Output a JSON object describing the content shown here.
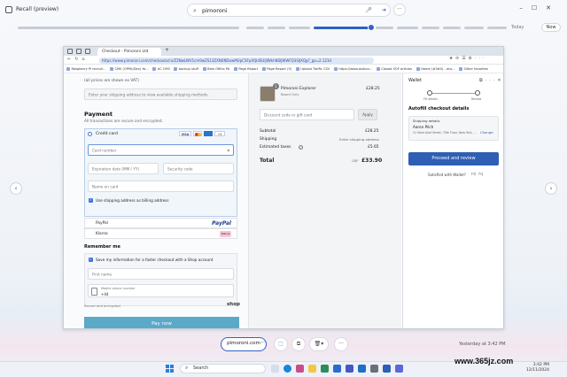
{
  "app": {
    "title": "Recall (preview)"
  },
  "search": {
    "query": "pimoroni"
  },
  "timeline": {
    "today_label": "Today",
    "now_label": "Now"
  },
  "browser": {
    "tab_title": "Checkout - Pimoroni Ltd",
    "url": "https://www.pimoroni.com/checkouts/cn/Z2NwLWV1cm9wZS13ZXN0NDowMUpCSFpXQldSUlJIWkhNSlJWWFQ3SlJXQg?_ga=2.1234",
    "bookmarks": [
      "Raspberry Pi recruit...",
      "CMS (OPM)(Dev) Yo...",
      "AC CMS",
      "backup stuff",
      "Best Office PA",
      "Page Report",
      "Page Report (5)",
      "Upload Traffic CSV",
      "https://www.avalon...",
      "Closed SOF articles",
      "Home (#3#0) - ans...",
      "Other favorites"
    ]
  },
  "checkout": {
    "prices_note": "(all prices are shown ex VAT)",
    "shipping_hint": "Enter your shipping address to view available shipping methods.",
    "payment_heading": "Payment",
    "payment_sub": "All transactions are secure and encrypted.",
    "credit_card_label": "Credit card",
    "card_brands": [
      "VISA",
      "MC",
      "AMEX",
      "+5"
    ],
    "card_number_placeholder": "Card number",
    "expiry_placeholder": "Expiration date (MM / YY)",
    "security_placeholder": "Security code",
    "name_placeholder": "Name on card",
    "billing_same_label": "Use shipping address as billing address",
    "paypal_label": "PayPal",
    "paypal_logo": "PayPal",
    "klarna_label": "Klarna",
    "klarna_logo": "Klarna",
    "remember_heading": "Remember me",
    "remember_label": "Save my information for a faster checkout with a Shop account",
    "first_name_placeholder": "First name",
    "mobile_label": "Mobile phone number",
    "mobile_prefix": "+44",
    "secure_note": "Secure and encrypted",
    "shop_logo": "shop",
    "pay_now": "Pay now"
  },
  "summary": {
    "item_name": "Pimoroni Explorer",
    "item_variant": "Board Only",
    "item_qty": "1",
    "item_price": "£28.25",
    "discount_placeholder": "Discount code or gift card",
    "apply_label": "Apply",
    "subtotal_label": "Subtotal",
    "subtotal_value": "£28.25",
    "shipping_label": "Shipping",
    "shipping_value": "Enter shipping address",
    "taxes_label": "Estimated taxes",
    "taxes_value": "£5.65",
    "total_label": "Total",
    "total_currency": "GBP",
    "total_value": "£33.90"
  },
  "wallet": {
    "title": "Wallet",
    "step1": "Fill details",
    "step2": "Review",
    "heading": "Autofill checkout details",
    "shipping_details_label": "Shipping details",
    "name": "Aaron Pilch",
    "address": "11 Mont Aloé Street, 70th Floor, New York, ...",
    "change_label": "Change",
    "proceed_label": "Proceed and review",
    "satisfied_text": "Satisfied with Wallet?"
  },
  "bottom": {
    "query_pill": "pimoroni.com",
    "more": "···",
    "timestamp": "Yesterday at 3:42 PM"
  },
  "taskbar": {
    "search_label": "Search",
    "time": "3:42 PM",
    "date": "12/11/2024"
  },
  "watermark": "www.365jz.com"
}
